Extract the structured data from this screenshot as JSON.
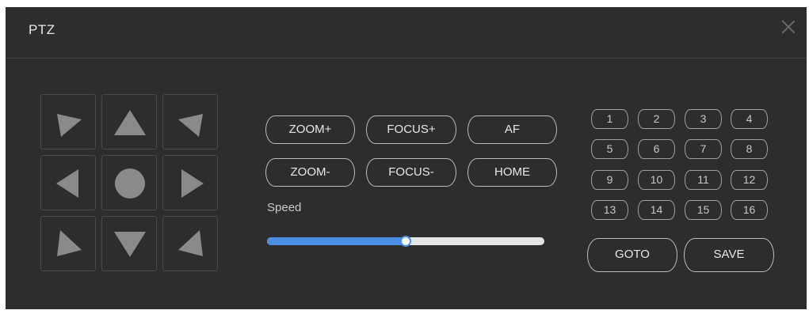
{
  "window": {
    "title": "PTZ",
    "close_icon": "close-icon"
  },
  "directional_pad": {
    "buttons": [
      {
        "name": "up-left",
        "icon": "arrow-up-left-icon"
      },
      {
        "name": "up",
        "icon": "arrow-up-icon"
      },
      {
        "name": "up-right",
        "icon": "arrow-up-right-icon"
      },
      {
        "name": "left",
        "icon": "arrow-left-icon"
      },
      {
        "name": "center",
        "icon": "stop-circle-icon"
      },
      {
        "name": "right",
        "icon": "arrow-right-icon"
      },
      {
        "name": "down-left",
        "icon": "arrow-down-left-icon"
      },
      {
        "name": "down",
        "icon": "arrow-down-icon"
      },
      {
        "name": "down-right",
        "icon": "arrow-down-right-icon"
      }
    ]
  },
  "lens_controls": {
    "zoom_in": "ZOOM+",
    "focus_in": "FOCUS+",
    "autofocus": "AF",
    "zoom_out": "ZOOM-",
    "focus_out": "FOCUS-",
    "home": "HOME"
  },
  "speed": {
    "label": "Speed",
    "value_fraction": 0.5
  },
  "presets": {
    "numbers": [
      "1",
      "2",
      "3",
      "4",
      "5",
      "6",
      "7",
      "8",
      "9",
      "10",
      "11",
      "12",
      "13",
      "14",
      "15",
      "16"
    ],
    "goto_label": "GOTO",
    "save_label": "SAVE"
  },
  "colors": {
    "panel_bg": "#2d2d2f",
    "slider_accent": "#4a90e2",
    "arrow_gray": "#8a8a8c"
  }
}
